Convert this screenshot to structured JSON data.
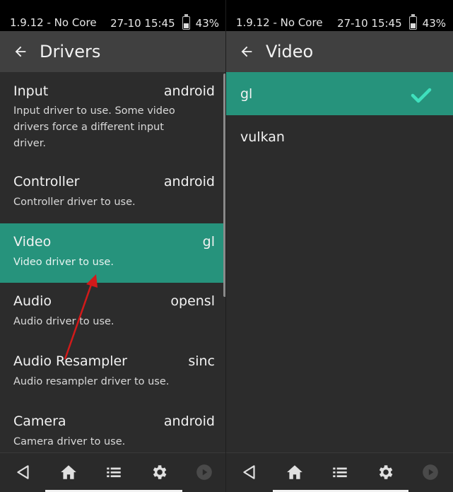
{
  "status_bar": {
    "left": "1.9.12 - No Core",
    "right_time": "27-10 15:45",
    "battery": "43%",
    "battery_level": 0.43
  },
  "left_pane": {
    "title": "Drivers",
    "items": [
      {
        "label": "Input",
        "value": "android",
        "desc": "Input driver to use. Some video drivers force a different input driver."
      },
      {
        "label": "Controller",
        "value": "android",
        "desc": "Controller driver to use."
      },
      {
        "label": "Video",
        "value": "gl",
        "desc": "Video driver to use."
      },
      {
        "label": "Audio",
        "value": "opensl",
        "desc": "Audio driver to use."
      },
      {
        "label": "Audio Resampler",
        "value": "sinc",
        "desc": "Audio resampler driver to use."
      },
      {
        "label": "Camera",
        "value": "android",
        "desc": "Camera driver to use."
      }
    ]
  },
  "right_pane": {
    "title": "Video",
    "options": [
      {
        "label": "gl"
      },
      {
        "label": "vulkan"
      }
    ]
  },
  "colors": {
    "accent": "#26937c",
    "check": "#3fe0bd",
    "annotation_arrow": "#d11a1a"
  },
  "nav_icons": [
    "back-triangle-icon",
    "home-icon",
    "list-icon",
    "gear-icon",
    "play-circle-icon"
  ]
}
